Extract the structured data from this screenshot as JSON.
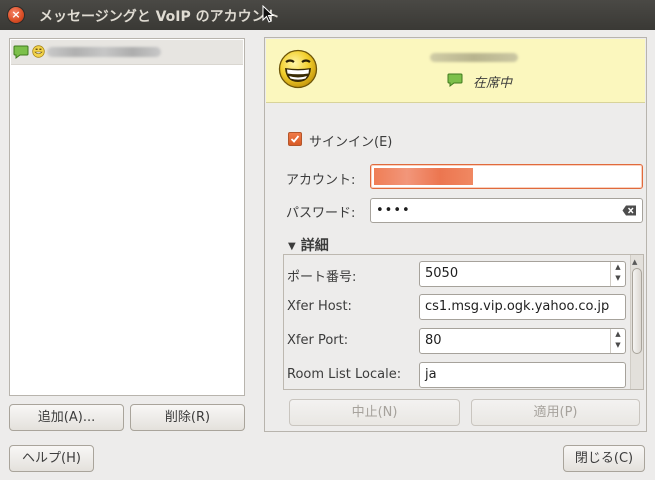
{
  "window": {
    "title": "メッセージングと VoIP のアカウント"
  },
  "icons": {
    "close": "close-icon",
    "status": "speech-bubble-green-icon",
    "protocol": "yahoo-smiley-icon",
    "clear": "clear-entry-icon"
  },
  "account_list": {
    "rows": [
      {
        "name_redacted": true
      }
    ]
  },
  "buttons": {
    "add": "追加(A)...",
    "delete": "削除(R)",
    "help": "ヘルプ(H)",
    "close": "閉じる(C)",
    "cancel": "中止(N)",
    "apply": "適用(P)"
  },
  "header": {
    "presence": "在席中"
  },
  "form": {
    "signin_label": "サインイン(E)",
    "signin_checked": true,
    "account_label": "アカウント:",
    "password_label": "パスワード:",
    "password_value": "••••",
    "details_label": "詳細",
    "port_label": "ポート番号:",
    "port_value": "5050",
    "xfer_host_label": "Xfer Host:",
    "xfer_host_value": "cs1.msg.vip.ogk.yahoo.co.jp",
    "xfer_port_label": "Xfer Port:",
    "xfer_port_value": "80",
    "room_locale_label": "Room List Locale:",
    "room_locale_value": "ja"
  },
  "colors": {
    "accent": "#e06a3c",
    "header_bg": "#fbf7be",
    "titlebar": "#3c3b37"
  }
}
